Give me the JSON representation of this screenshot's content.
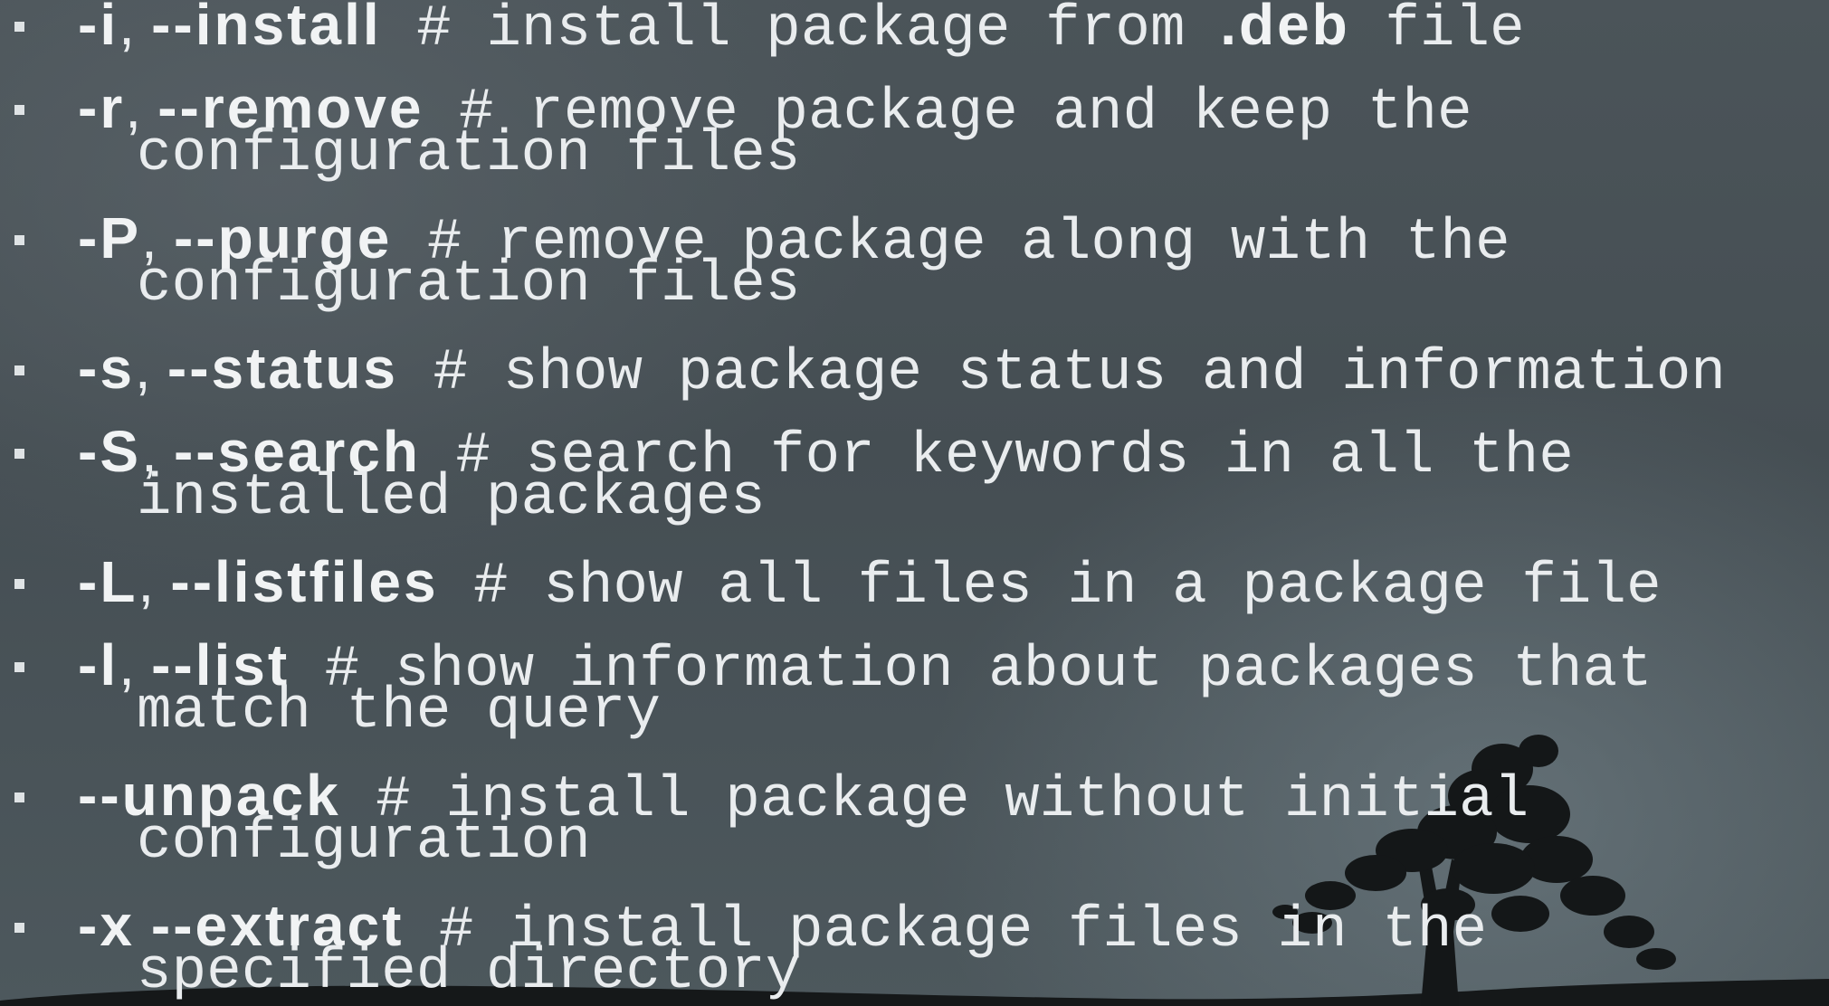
{
  "options": [
    {
      "short": "-i",
      "sep": ", ",
      "long": "--install",
      "desc1_pre": " # install package from ",
      "ext": ".deb",
      "desc1_post": " file",
      "desc2": ""
    },
    {
      "short": "-r",
      "sep": ", ",
      "long": "--remove",
      "desc1_pre": " # remove package and keep the",
      "ext": "",
      "desc1_post": "",
      "desc2": "configuration files"
    },
    {
      "short": "-P",
      "sep": ", ",
      "long": "--purge",
      "desc1_pre": " # remove package along with the",
      "ext": "",
      "desc1_post": "",
      "desc2": "configuration files"
    },
    {
      "short": "-s",
      "sep": ", ",
      "long": "--status",
      "desc1_pre": " # show package status and information",
      "ext": "",
      "desc1_post": "",
      "desc2": ""
    },
    {
      "short": "-S",
      "sep": ", ",
      "long": "--search",
      "desc1_pre": " # search for keywords in all the",
      "ext": "",
      "desc1_post": "",
      "desc2": "installed packages"
    },
    {
      "short": "-L",
      "sep": ", ",
      "long": "--listfiles",
      "desc1_pre": " # show all files in a package file",
      "ext": "",
      "desc1_post": "",
      "desc2": ""
    },
    {
      "short": "-l",
      "sep": ", ",
      "long": "--list",
      "desc1_pre": " # show information about packages that",
      "ext": "",
      "desc1_post": "",
      "desc2": "match the query"
    },
    {
      "short": "",
      "sep": "",
      "long": "--unpack",
      "desc1_pre": " # install package without initial",
      "ext": "",
      "desc1_post": "",
      "desc2": "configuration"
    },
    {
      "short": "-x",
      "sep": " ",
      "long": "--extract",
      "desc1_pre": " # install package files in the",
      "ext": "",
      "desc1_post": "",
      "desc2": "specified directory"
    }
  ]
}
